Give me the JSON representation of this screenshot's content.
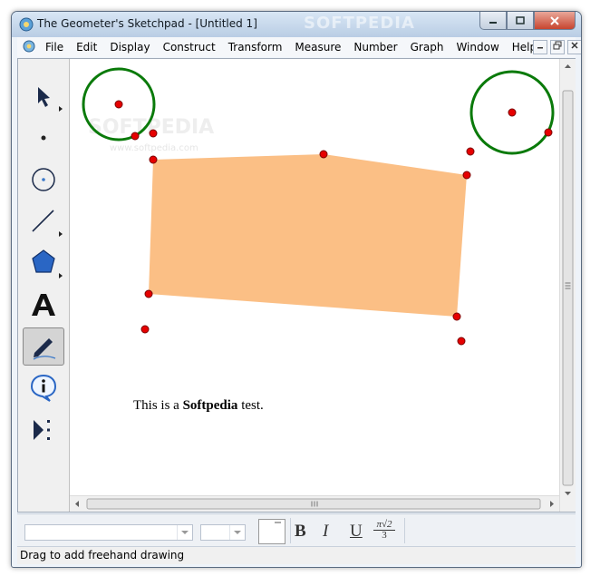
{
  "window": {
    "title": "The Geometer's Sketchpad - [Untitled 1]",
    "watermark": "SOFTPEDIA"
  },
  "menubar": {
    "items": [
      "File",
      "Edit",
      "Display",
      "Construct",
      "Transform",
      "Measure",
      "Number",
      "Graph",
      "Window",
      "Help"
    ]
  },
  "toolbox": {
    "tools": [
      "arrow-select-tool",
      "point-tool",
      "compass-tool",
      "straightedge-tool",
      "polygon-tool",
      "text-tool",
      "marker-tool",
      "information-tool",
      "custom-tool"
    ],
    "active_tool": "marker-tool"
  },
  "canvas": {
    "text_plain": "This is a ",
    "text_bold": "Softpedia",
    "text_end": " test.",
    "polygon_fill": "#fbbf85",
    "circle_stroke": "#0a7a0a",
    "point_fill": "#e60000",
    "canvas_watermark": "SOFTPEDIA",
    "canvas_watermark_url": "www.softpedia.com"
  },
  "format_bar": {
    "font_name": "",
    "font_size": "",
    "bold_label": "B",
    "italic_label": "I",
    "underline_label": "U",
    "math_numerator": "π√2",
    "math_denominator": "3"
  },
  "status": {
    "text": "Drag to add freehand drawing"
  }
}
